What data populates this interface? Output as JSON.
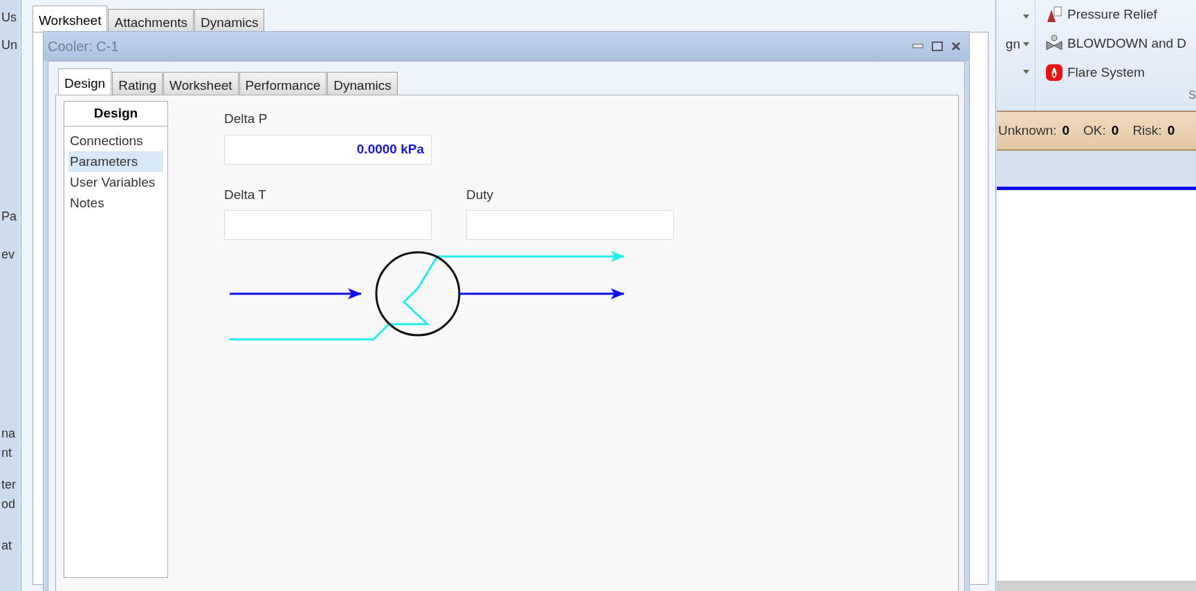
{
  "background_app": {
    "left_fragments": [
      "Us",
      "Un",
      "Pa",
      "ev",
      "na",
      "nt",
      "ter",
      "od",
      "at"
    ],
    "tabs": [
      {
        "label": "Worksheet",
        "selected": true
      },
      {
        "label": "Attachments",
        "selected": false
      },
      {
        "label": "Dynamics",
        "selected": false
      }
    ],
    "ribbon": {
      "dropdowns": [
        {
          "kind": "caret"
        },
        {
          "kind": "labeled",
          "label": "gn"
        },
        {
          "kind": "caret"
        }
      ],
      "items": [
        {
          "label": "Pressure Relief",
          "kind": "relief"
        },
        {
          "label": "BLOWDOWN and D",
          "kind": "blowdown"
        },
        {
          "label": "Flare System",
          "kind": "flare"
        }
      ],
      "group_label": "S"
    },
    "status_bar": [
      {
        "label": "Unknown:",
        "value": "0"
      },
      {
        "label": "OK:",
        "value": "0"
      },
      {
        "label": "Risk:",
        "value": "0"
      }
    ]
  },
  "window": {
    "title": "Cooler: C-1",
    "tabs": [
      {
        "label": "Design",
        "selected": true
      },
      {
        "label": "Rating",
        "selected": false
      },
      {
        "label": "Worksheet",
        "selected": false
      },
      {
        "label": "Performance",
        "selected": false
      },
      {
        "label": "Dynamics",
        "selected": false
      }
    ],
    "sidebar": {
      "header": "Design",
      "items": [
        {
          "label": "Connections",
          "selected": false
        },
        {
          "label": "Parameters",
          "selected": true
        },
        {
          "label": "User Variables",
          "selected": false
        },
        {
          "label": "Notes",
          "selected": false
        }
      ]
    },
    "fields": [
      {
        "label": "Delta P",
        "value": "0.0000 kPa"
      },
      {
        "label": "Delta T"
      },
      {
        "label": "Duty"
      }
    ]
  }
}
